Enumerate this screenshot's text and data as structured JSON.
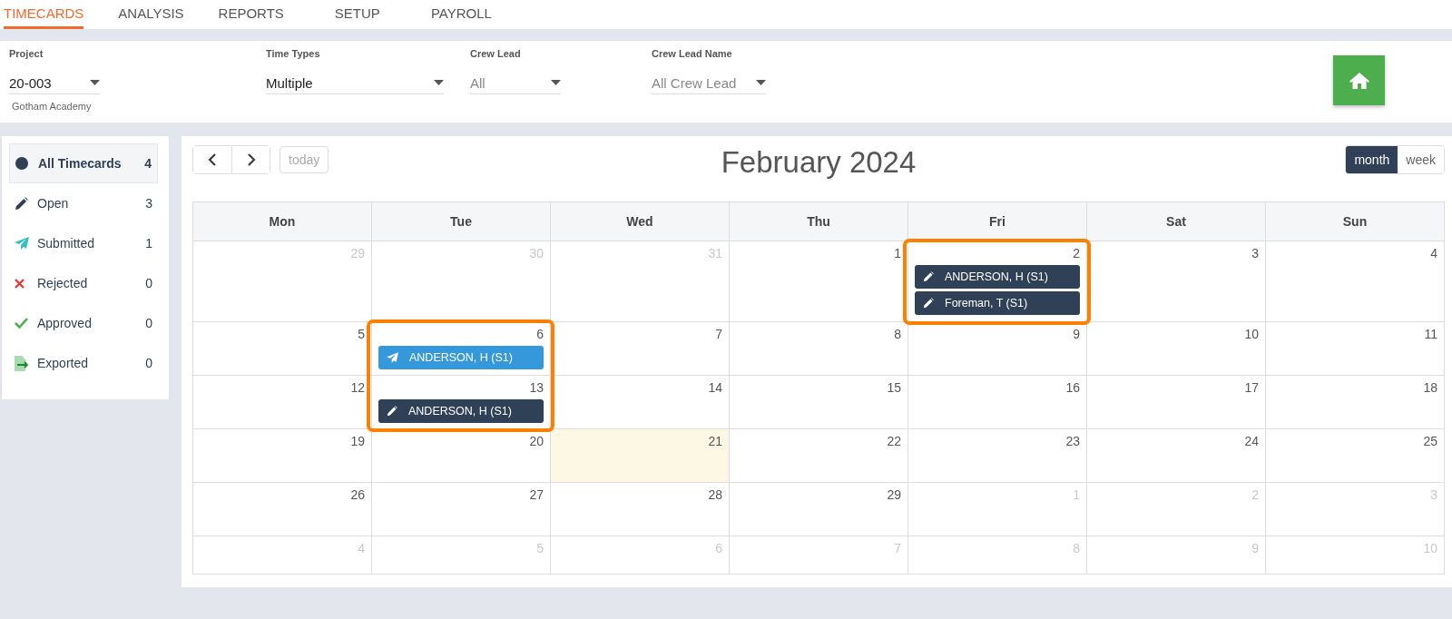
{
  "nav_tabs": [
    {
      "label": "TIMECARDS",
      "selected": true
    },
    {
      "label": "ANALYSIS",
      "selected": false
    },
    {
      "label": "REPORTS",
      "selected": false
    },
    {
      "label": "SETUP",
      "selected": false
    },
    {
      "label": "PAYROLL",
      "selected": false
    }
  ],
  "filters": [
    {
      "label": "Project",
      "value": "20-003",
      "caption": "Gotham Academy"
    },
    {
      "label": "Time Types",
      "value": "Multiple"
    },
    {
      "label": "Crew Lead",
      "placeholder": "All"
    },
    {
      "label": "Crew Lead Name",
      "placeholder": "All Crew Lead"
    }
  ],
  "sidebar": {
    "items": [
      {
        "kind": "all",
        "label": "All Timecards",
        "count": "4",
        "selected": true
      },
      {
        "kind": "open",
        "label": "Open",
        "count": "3",
        "selected": false
      },
      {
        "kind": "submitted",
        "label": "Submitted",
        "count": "1",
        "selected": false
      },
      {
        "kind": "rejected",
        "label": "Rejected",
        "count": "0",
        "selected": false
      },
      {
        "kind": "approved",
        "label": "Approved",
        "count": "0",
        "selected": false
      },
      {
        "kind": "exported",
        "label": "Exported",
        "count": "0",
        "selected": false
      }
    ]
  },
  "calendar": {
    "title": "February 2024",
    "today_button": "today",
    "views": [
      {
        "label": "month",
        "selected": true
      },
      {
        "label": "week",
        "selected": false
      }
    ],
    "weekdays": [
      "Mon",
      "Tue",
      "Wed",
      "Thu",
      "Fri",
      "Sat",
      "Sun"
    ],
    "weeks": [
      [
        {
          "day": "29",
          "other_month": true,
          "today": false,
          "highlighted": false
        },
        {
          "day": "30",
          "other_month": true,
          "today": false,
          "highlighted": false
        },
        {
          "day": "31",
          "other_month": true,
          "today": false,
          "highlighted": false
        },
        {
          "day": "1",
          "other_month": false,
          "today": false,
          "highlighted": false
        },
        {
          "day": "2",
          "other_month": false,
          "today": false,
          "highlighted": true,
          "events": [
            {
              "kind": "open",
              "label": "ANDERSON, H (S1)"
            },
            {
              "kind": "open",
              "label": "Foreman, T (S1)"
            }
          ]
        },
        {
          "day": "3",
          "other_month": false,
          "today": false,
          "highlighted": false
        },
        {
          "day": "4",
          "other_month": false,
          "today": false,
          "highlighted": false
        }
      ],
      [
        {
          "day": "5",
          "other_month": false,
          "today": false,
          "highlighted": false
        },
        {
          "day": "6",
          "other_month": false,
          "today": false,
          "highlighted": true,
          "events": [
            {
              "kind": "submitted",
              "label": "ANDERSON, H (S1)"
            }
          ]
        },
        {
          "day": "7",
          "other_month": false,
          "today": false,
          "highlighted": false
        },
        {
          "day": "8",
          "other_month": false,
          "today": false,
          "highlighted": false
        },
        {
          "day": "9",
          "other_month": false,
          "today": false,
          "highlighted": false
        },
        {
          "day": "10",
          "other_month": false,
          "today": false,
          "highlighted": false
        },
        {
          "day": "11",
          "other_month": false,
          "today": false,
          "highlighted": false
        }
      ],
      [
        {
          "day": "12",
          "other_month": false,
          "today": false,
          "highlighted": false
        },
        {
          "day": "13",
          "other_month": false,
          "today": false,
          "highlighted": true,
          "events": [
            {
              "kind": "open",
              "label": "ANDERSON, H (S1)"
            }
          ]
        },
        {
          "day": "14",
          "other_month": false,
          "today": false,
          "highlighted": false
        },
        {
          "day": "15",
          "other_month": false,
          "today": false,
          "highlighted": false
        },
        {
          "day": "16",
          "other_month": false,
          "today": false,
          "highlighted": false
        },
        {
          "day": "17",
          "other_month": false,
          "today": false,
          "highlighted": false
        },
        {
          "day": "18",
          "other_month": false,
          "today": false,
          "highlighted": false
        }
      ],
      [
        {
          "day": "19",
          "other_month": false,
          "today": false,
          "highlighted": false
        },
        {
          "day": "20",
          "other_month": false,
          "today": false,
          "highlighted": false
        },
        {
          "day": "21",
          "other_month": false,
          "today": true,
          "highlighted": false
        },
        {
          "day": "22",
          "other_month": false,
          "today": false,
          "highlighted": false
        },
        {
          "day": "23",
          "other_month": false,
          "today": false,
          "highlighted": false
        },
        {
          "day": "24",
          "other_month": false,
          "today": false,
          "highlighted": false
        },
        {
          "day": "25",
          "other_month": false,
          "today": false,
          "highlighted": false
        }
      ],
      [
        {
          "day": "26",
          "other_month": false,
          "today": false,
          "highlighted": false
        },
        {
          "day": "27",
          "other_month": false,
          "today": false,
          "highlighted": false
        },
        {
          "day": "28",
          "other_month": false,
          "today": false,
          "highlighted": false
        },
        {
          "day": "29",
          "other_month": false,
          "today": false,
          "highlighted": false
        },
        {
          "day": "1",
          "other_month": true,
          "today": false,
          "highlighted": false
        },
        {
          "day": "2",
          "other_month": true,
          "today": false,
          "highlighted": false
        },
        {
          "day": "3",
          "other_month": true,
          "today": false,
          "highlighted": false
        }
      ],
      [
        {
          "day": "4",
          "other_month": true,
          "today": false,
          "highlighted": false
        },
        {
          "day": "5",
          "other_month": true,
          "today": false,
          "highlighted": false
        },
        {
          "day": "6",
          "other_month": true,
          "today": false,
          "highlighted": false
        },
        {
          "day": "7",
          "other_month": true,
          "today": false,
          "highlighted": false
        },
        {
          "day": "8",
          "other_month": true,
          "today": false,
          "highlighted": false
        },
        {
          "day": "9",
          "other_month": true,
          "today": false,
          "highlighted": false
        },
        {
          "day": "10",
          "other_month": true,
          "today": false,
          "highlighted": false
        }
      ]
    ]
  }
}
